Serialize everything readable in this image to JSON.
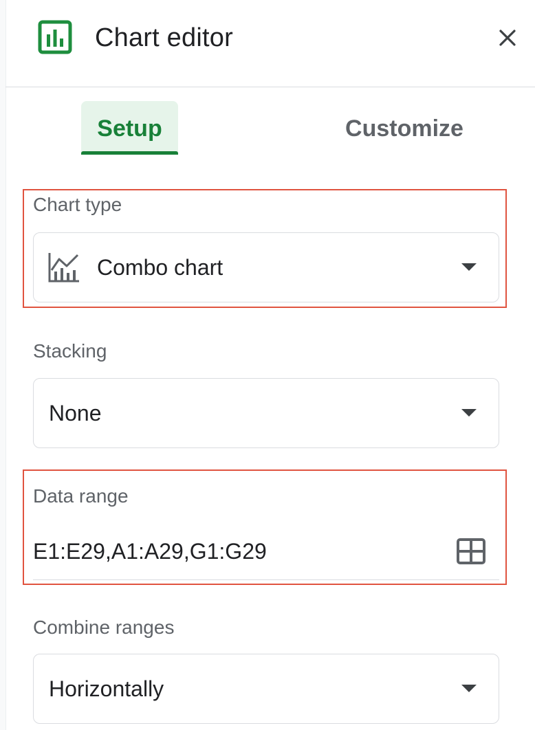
{
  "header": {
    "title": "Chart editor",
    "icon": "chart-icon",
    "close_icon": "close-icon",
    "accent_color": "#1e8e3e"
  },
  "tabs": [
    {
      "label": "Setup",
      "active": true,
      "active_color": "#188038",
      "active_bg": "#e6f4ea"
    },
    {
      "label": "Customize",
      "active": false
    }
  ],
  "chart_type": {
    "label": "Chart type",
    "value": "Combo chart",
    "icon": "combo-chart-icon"
  },
  "stacking": {
    "label": "Stacking",
    "value": "None"
  },
  "data_range": {
    "label": "Data range",
    "value": "E1:E29,A1:A29,G1:G29",
    "icon": "grid-icon"
  },
  "combine_ranges": {
    "label": "Combine ranges",
    "value": "Horizontally"
  },
  "annotation_color": "#e0533f"
}
